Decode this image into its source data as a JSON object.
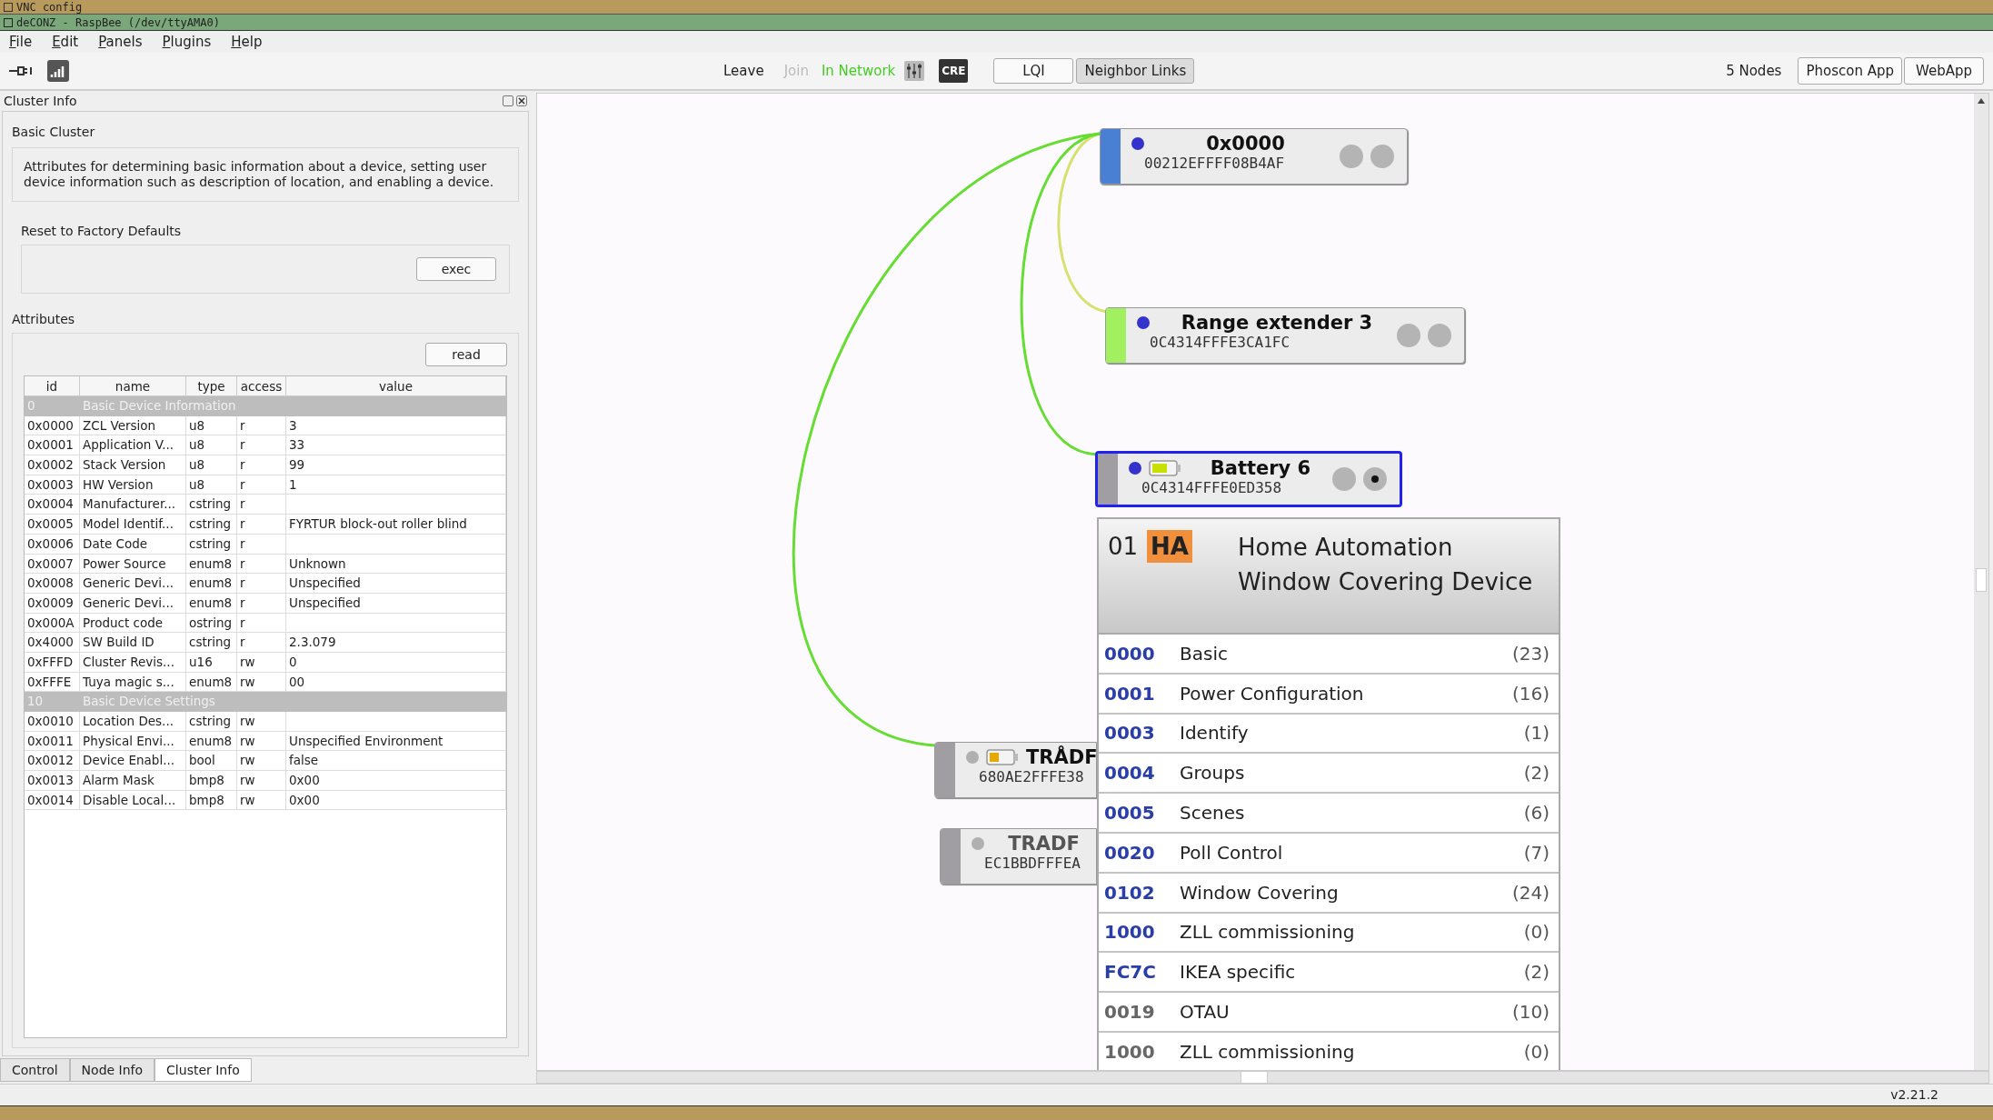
{
  "title_bars": {
    "vnc": "VNC config",
    "window": "deCONZ - RaspBee (/dev/ttyAMA0)"
  },
  "menu": [
    "File",
    "Edit",
    "Panels",
    "Plugins",
    "Help"
  ],
  "toolbar": {
    "leave": "Leave",
    "join": {
      "label": "Join",
      "disabled": true
    },
    "status": "In Network",
    "cre": "CRE",
    "toggles": [
      {
        "label": "LQI",
        "selected": false
      },
      {
        "label": "Neighbor Links",
        "selected": true
      }
    ],
    "nodes_count": "5 Nodes",
    "buttons": [
      "Phoscon App",
      "WebApp"
    ]
  },
  "panel": {
    "title": "Cluster Info",
    "cluster": "Basic Cluster",
    "description": "Attributes for determining basic information about a device, setting user device information such as description of location, and enabling a device.",
    "command": {
      "label": "Reset to Factory Defaults",
      "button": "exec"
    },
    "attributes": {
      "title": "Attributes",
      "read_button": "read",
      "columns": [
        "id",
        "name",
        "type",
        "access",
        "value"
      ],
      "rows": [
        {
          "kind": "group",
          "id": "0",
          "name": "Basic Device Information"
        },
        {
          "kind": "attribute",
          "id": "0x0000",
          "name": "ZCL Version",
          "type": "u8",
          "access": "r",
          "value": "3"
        },
        {
          "kind": "attribute",
          "id": "0x0001",
          "name": "Application V...",
          "type": "u8",
          "access": "r",
          "value": "33"
        },
        {
          "kind": "attribute",
          "id": "0x0002",
          "name": "Stack Version",
          "type": "u8",
          "access": "r",
          "value": "99"
        },
        {
          "kind": "attribute",
          "id": "0x0003",
          "name": "HW Version",
          "type": "u8",
          "access": "r",
          "value": "1"
        },
        {
          "kind": "attribute",
          "id": "0x0004",
          "name": "Manufacturer...",
          "type": "cstring",
          "access": "r"
        },
        {
          "kind": "attribute",
          "id": "0x0005",
          "name": "Model Identif...",
          "type": "cstring",
          "access": "r",
          "value": "FYRTUR block-out roller blind"
        },
        {
          "kind": "attribute",
          "id": "0x0006",
          "name": "Date Code",
          "type": "cstring",
          "access": "r"
        },
        {
          "kind": "attribute",
          "id": "0x0007",
          "name": "Power Source",
          "type": "enum8",
          "access": "r",
          "value": "Unknown"
        },
        {
          "kind": "attribute",
          "id": "0x0008",
          "name": "Generic Devi...",
          "type": "enum8",
          "access": "r",
          "value": "Unspecified"
        },
        {
          "kind": "attribute",
          "id": "0x0009",
          "name": "Generic Devi...",
          "type": "enum8",
          "access": "r",
          "value": "Unspecified"
        },
        {
          "kind": "attribute",
          "id": "0x000A",
          "name": "Product code",
          "type": "ostring",
          "access": "r"
        },
        {
          "kind": "attribute",
          "id": "0x4000",
          "name": "SW Build ID",
          "type": "cstring",
          "access": "r",
          "value": "2.3.079"
        },
        {
          "kind": "attribute",
          "id": "0xFFFD",
          "name": "Cluster Revis...",
          "type": "u16",
          "access": "rw",
          "value": "0"
        },
        {
          "kind": "attribute",
          "id": "0xFFFE",
          "name": "Tuya magic s...",
          "type": "enum8",
          "access": "rw",
          "value": "00"
        },
        {
          "kind": "group",
          "id": "10",
          "name": "Basic Device Settings"
        },
        {
          "kind": "attribute",
          "id": "0x0010",
          "name": "Location Des...",
          "type": "cstring",
          "access": "rw"
        },
        {
          "kind": "attribute",
          "id": "0x0011",
          "name": "Physical Envi...",
          "type": "enum8",
          "access": "rw",
          "value": "Unspecified Environment"
        },
        {
          "kind": "attribute",
          "id": "0x0012",
          "name": "Device Enabl...",
          "type": "bool",
          "access": "rw",
          "value": "false"
        },
        {
          "kind": "attribute",
          "id": "0x0013",
          "name": "Alarm Mask",
          "type": "bmp8",
          "access": "rw",
          "value": "0x00"
        },
        {
          "kind": "attribute",
          "id": "0x0014",
          "name": "Disable Local...",
          "type": "bmp8",
          "access": "rw",
          "value": "0x00"
        }
      ]
    }
  },
  "bottom_tabs": [
    {
      "label": "Control",
      "selected": false
    },
    {
      "label": "Node Info",
      "selected": false
    },
    {
      "label": "Cluster Info",
      "selected": true
    }
  ],
  "canvas": {
    "nodes": [
      {
        "name": "0x0000",
        "address": "00212EFFFF08B4AF",
        "color": "#4a80d4",
        "online": true,
        "battery": false,
        "selected": false,
        "endpoints": [
          {
            "selected": false
          },
          {
            "selected": false
          }
        ]
      },
      {
        "name": "Range extender 3",
        "address": "0C4314FFFE3CA1FC",
        "color": "#a0f060",
        "online": true,
        "battery": false,
        "selected": false,
        "link": {
          "color": "#d8e070"
        },
        "endpoints": [
          {
            "selected": false
          },
          {
            "selected": false
          }
        ]
      },
      {
        "name": "Battery 6",
        "address": "0C4314FFFE0ED358",
        "color": "#a09ea2",
        "online": true,
        "battery": true,
        "selected": true,
        "link": {
          "color": "#66dd33"
        },
        "endpoints": [
          {
            "selected": false
          },
          {
            "selected": true
          }
        ]
      },
      {
        "name": "TRÅDF",
        "address": "680AE2FFFE38",
        "color": "#a09ea2",
        "online": false,
        "battery": true,
        "selected": false,
        "link": {
          "color": "#66dd33"
        }
      },
      {
        "name": "TRADF",
        "address": "EC1BBDFFFEA",
        "color": "#a09ea2",
        "online": false,
        "battery": false,
        "selected": false
      }
    ],
    "endpoint": {
      "id": "01",
      "profile": "HA",
      "title": [
        "Home Automation",
        "Window Covering Device"
      ],
      "clusters": [
        {
          "id": "0000",
          "name": "Basic",
          "count": "(23)",
          "kind": "server"
        },
        {
          "id": "0001",
          "name": "Power Configuration",
          "count": "(16)",
          "kind": "server"
        },
        {
          "id": "0003",
          "name": "Identify",
          "count": "(1)",
          "kind": "server"
        },
        {
          "id": "0004",
          "name": "Groups",
          "count": "(2)",
          "kind": "server"
        },
        {
          "id": "0005",
          "name": "Scenes",
          "count": "(6)",
          "kind": "server"
        },
        {
          "id": "0020",
          "name": "Poll Control",
          "count": "(7)",
          "kind": "server"
        },
        {
          "id": "0102",
          "name": "Window Covering",
          "count": "(24)",
          "kind": "server"
        },
        {
          "id": "1000",
          "name": "ZLL commissioning",
          "count": "(0)",
          "kind": "server"
        },
        {
          "id": "FC7C",
          "name": "IKEA specific",
          "count": "(2)",
          "kind": "server"
        },
        {
          "id": "0019",
          "name": "OTAU",
          "count": "(10)",
          "kind": "client"
        },
        {
          "id": "1000",
          "name": "ZLL commissioning",
          "count": "(0)",
          "kind": "client"
        }
      ]
    }
  },
  "status_bar": {
    "version": "v2.21.2"
  }
}
